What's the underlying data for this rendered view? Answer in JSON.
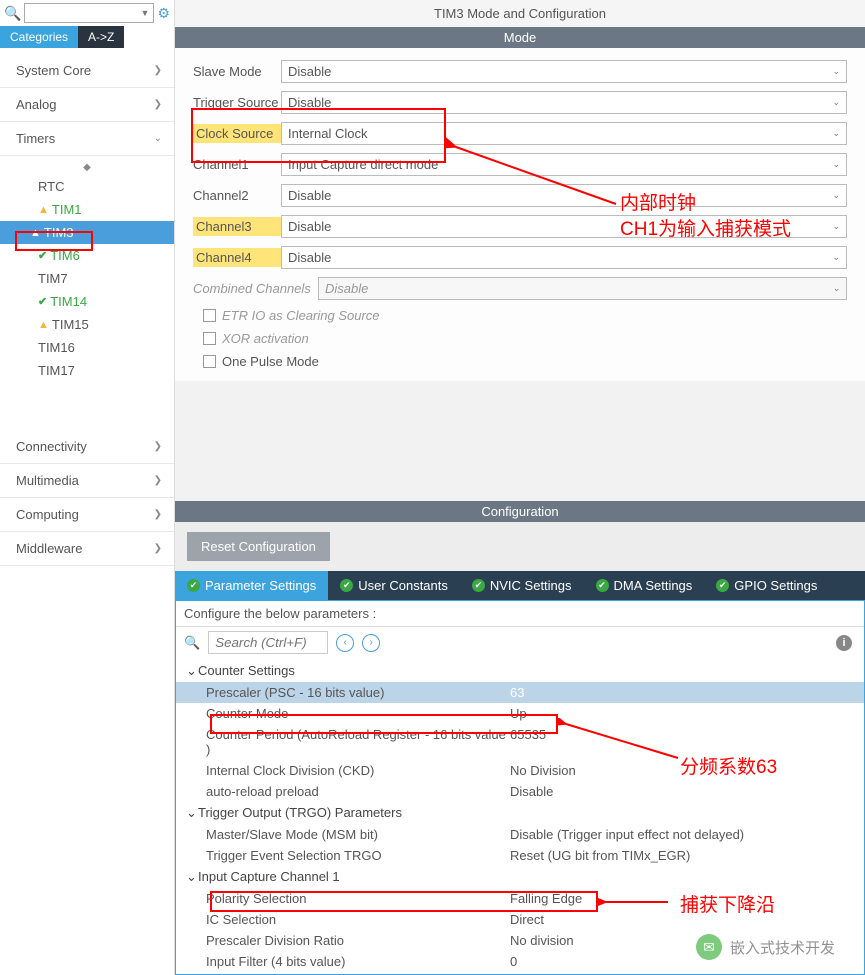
{
  "sidebar": {
    "tabs": {
      "categories": "Categories",
      "az": "A->Z"
    },
    "groups": [
      {
        "label": "System Core",
        "expanded": false
      },
      {
        "label": "Analog",
        "expanded": false
      },
      {
        "label": "Timers",
        "expanded": true
      },
      {
        "label": "Connectivity",
        "expanded": false
      },
      {
        "label": "Multimedia",
        "expanded": false
      },
      {
        "label": "Computing",
        "expanded": false
      },
      {
        "label": "Middleware",
        "expanded": false
      }
    ],
    "timers_items": [
      {
        "label": "RTC",
        "icon": ""
      },
      {
        "label": "TIM1",
        "icon": "warn"
      },
      {
        "label": "TIM3",
        "icon": "warn",
        "selected": true
      },
      {
        "label": "TIM6",
        "icon": "check"
      },
      {
        "label": "TIM7",
        "icon": ""
      },
      {
        "label": "TIM14",
        "icon": "check"
      },
      {
        "label": "TIM15",
        "icon": "warn"
      },
      {
        "label": "TIM16",
        "icon": ""
      },
      {
        "label": "TIM17",
        "icon": ""
      }
    ]
  },
  "main": {
    "title": "TIM3 Mode and Configuration",
    "mode_header": "Mode",
    "mode_rows": [
      {
        "label": "Slave Mode",
        "value": "Disable",
        "hl": false
      },
      {
        "label": "Trigger Source",
        "value": "Disable",
        "hl": false
      },
      {
        "label": "Clock Source",
        "value": "Internal Clock",
        "hl": true
      },
      {
        "label": "Channel1",
        "value": "Input Capture direct mode",
        "hl": false
      },
      {
        "label": "Channel2",
        "value": "Disable",
        "hl": false
      },
      {
        "label": "Channel3",
        "value": "Disable",
        "hl": true
      },
      {
        "label": "Channel4",
        "value": "Disable",
        "hl": true
      }
    ],
    "combined": {
      "label": "Combined Channels",
      "value": "Disable"
    },
    "checkboxes": [
      {
        "label": "ETR IO as Clearing Source",
        "disabled": true
      },
      {
        "label": "XOR activation",
        "disabled": true
      },
      {
        "label": "One Pulse Mode",
        "disabled": false
      }
    ],
    "config_header": "Configuration",
    "reset_btn": "Reset Configuration",
    "config_tabs": [
      "Parameter Settings",
      "User Constants",
      "NVIC Settings",
      "DMA Settings",
      "GPIO Settings"
    ],
    "config_desc": "Configure the below parameters :",
    "search_placeholder": "Search (Ctrl+F)",
    "tree": {
      "g0": {
        "label": "Counter Settings",
        "rows": [
          {
            "label": "Prescaler (PSC - 16 bits value)",
            "val": "63"
          },
          {
            "label": "Counter Mode",
            "val": "Up"
          },
          {
            "label": "Counter Period (AutoReload Register - 16 bits value )",
            "val": "65535"
          },
          {
            "label": "Internal Clock Division (CKD)",
            "val": "No Division"
          },
          {
            "label": "auto-reload preload",
            "val": "Disable"
          }
        ]
      },
      "g1": {
        "label": "Trigger Output (TRGO) Parameters",
        "rows": [
          {
            "label": "Master/Slave Mode (MSM bit)",
            "val": "Disable (Trigger input effect not delayed)"
          },
          {
            "label": "Trigger Event Selection TRGO",
            "val": "Reset (UG bit from TIMx_EGR)"
          }
        ]
      },
      "g2": {
        "label": "Input Capture Channel 1",
        "rows": [
          {
            "label": "Polarity Selection",
            "val": "Falling Edge"
          },
          {
            "label": "IC Selection",
            "val": "Direct"
          },
          {
            "label": "Prescaler Division Ratio",
            "val": "No division"
          },
          {
            "label": "Input Filter (4 bits value)",
            "val": "0"
          }
        ]
      }
    }
  },
  "annotations": {
    "a1": "内部时钟",
    "a2": "CH1为输入捕获模式",
    "a3": "分频系数63",
    "a4": "捕获下降沿"
  },
  "wechat": "嵌入式技术开发"
}
